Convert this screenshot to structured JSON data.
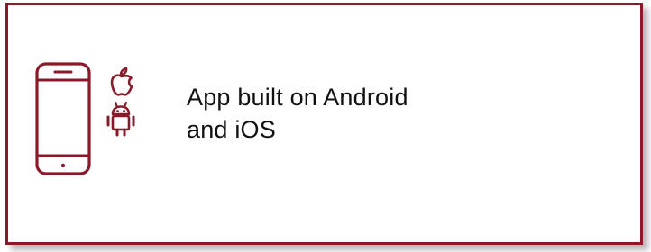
{
  "card": {
    "border_color": "#8a1a2a",
    "text_lines": [
      "App built on Android",
      "and iOS"
    ]
  },
  "icons": {
    "phone": "smartphone-icon",
    "apple": "apple-icon",
    "android": "android-icon",
    "color": "#8a1a2a"
  }
}
